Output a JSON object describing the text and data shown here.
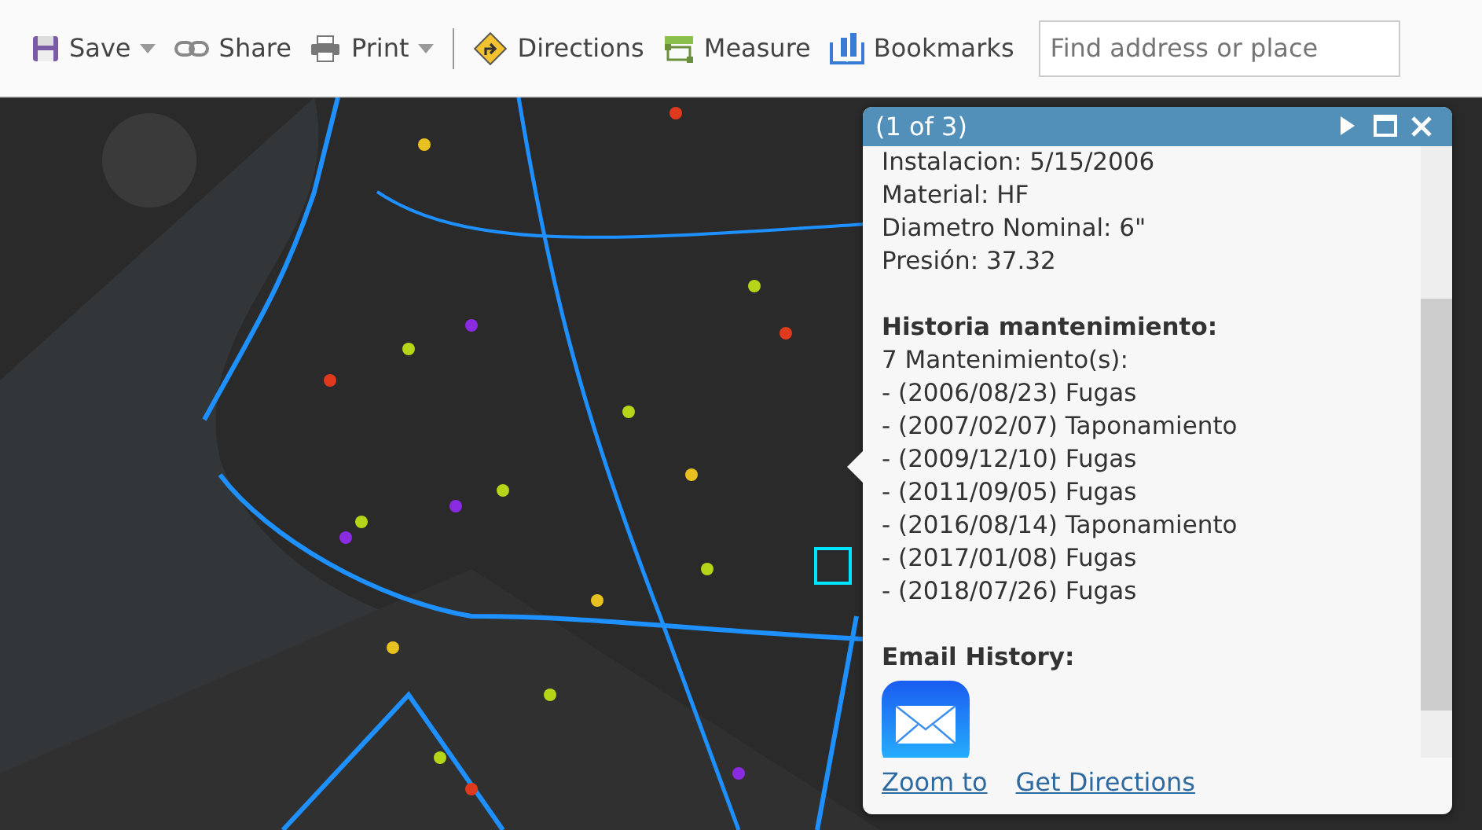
{
  "toolbar": {
    "items": [
      {
        "kind": "save",
        "label": "Save",
        "dropdown": true
      },
      {
        "kind": "share",
        "label": "Share",
        "dropdown": false
      },
      {
        "kind": "print",
        "label": "Print",
        "dropdown": true
      },
      {
        "kind": "directions",
        "label": "Directions",
        "dropdown": false
      },
      {
        "kind": "measure",
        "label": "Measure",
        "dropdown": false
      },
      {
        "kind": "bookmarks",
        "label": "Bookmarks",
        "dropdown": false
      }
    ],
    "search": {
      "placeholder": "Find address or place"
    }
  },
  "popup": {
    "title": "(1 of 3)",
    "attributes": [
      "Instalacion: 5/15/2006",
      "Material: HF",
      "Diametro Nominal: 6\"",
      "Presión: 37.32"
    ],
    "history_heading": "Historia mantenimiento:",
    "history_count": "7 Mantenimiento(s):",
    "history": [
      "- (2006/08/23) Fugas",
      "- (2007/02/07) Taponamiento",
      "- (2009/12/10) Fugas",
      "- (2011/09/05) Fugas",
      "- (2016/08/14) Taponamiento",
      "- (2017/01/08) Fugas",
      "- (2018/07/26) Fugas"
    ],
    "email_heading": "Email History:",
    "links": [
      "Zoom to",
      "Get Directions"
    ]
  }
}
